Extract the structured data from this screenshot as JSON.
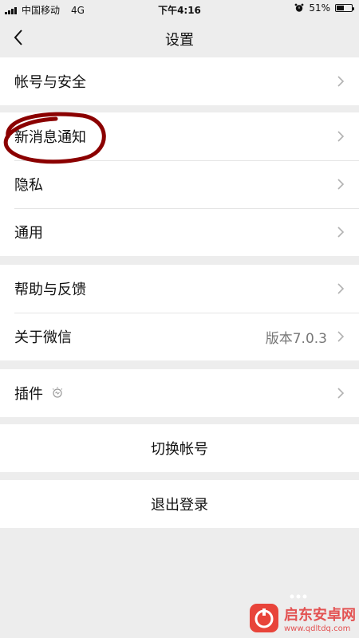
{
  "status_bar": {
    "carrier": "中国移动",
    "network": "4G",
    "time": "下午4:16",
    "battery_percent_text": "51%",
    "battery_level": 0.51
  },
  "nav": {
    "title": "设置",
    "back_icon": "chevron-left-icon"
  },
  "groups": [
    [
      {
        "label": "帐号与安全"
      }
    ],
    [
      {
        "label": "新消息通知"
      },
      {
        "label": "隐私"
      },
      {
        "label": "通用"
      }
    ],
    [
      {
        "label": "帮助与反馈"
      },
      {
        "label": "关于微信",
        "value": "版本7.0.3"
      }
    ],
    [
      {
        "label": "插件",
        "icon": "plugin-icon"
      }
    ]
  ],
  "actions": {
    "switch_account": "切换帐号",
    "logout": "退出登录"
  },
  "annotation": {
    "color": "#8b0000",
    "target": "新消息通知"
  },
  "watermark": {
    "title": "启东安卓网",
    "url": "www.qdltdq.com"
  }
}
